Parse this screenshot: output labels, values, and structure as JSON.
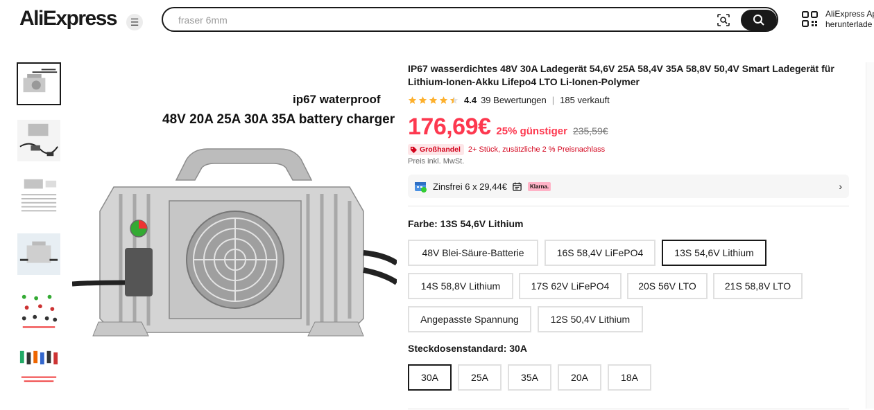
{
  "header": {
    "logo": "AliExpress",
    "search_placeholder": "fraser 6mm",
    "app_line1": "AliExpress Ap",
    "app_line2": "herunterlade"
  },
  "gallery": {
    "image_text_line1": "ip67 waterproof",
    "image_text_line2": "48V 20A 25A 30A 35A battery charger"
  },
  "product": {
    "title": "IP67 wasserdichtes 48V 30A Ladegerät 54,6V 25A 58,4V 35A 58,8V 50,4V Smart Ladegerät für Lithium-Ionen-Akku Lifepo4 LTO Li-Ionen-Polymer",
    "rating": "4.4",
    "reviews": "39 Bewertungen",
    "separator": "|",
    "sold": "185 verkauft",
    "stars": 4.4,
    "price": "176,69€",
    "discount": "25% günstiger",
    "old_price": "235,59€",
    "bulk_badge": "Großhandel",
    "bulk_text": "2+ Stück, zusätzliche 2 % Preisnachlass",
    "tax_note": "Preis inkl. MwSt.",
    "installment": "Zinsfrei 6 x 29,44€",
    "klarna": "Klarna."
  },
  "color": {
    "label": "Farbe: 13S 54,6V Lithium",
    "options": [
      "48V Blei-Säure-Batterie",
      "16S 58,4V LiFePO4",
      "13S 54,6V Lithium",
      "14S 58,8V Lithium",
      "17S 62V LiFePO4",
      "20S 56V LTO",
      "21S 58,8V LTO",
      "Angepasste Spannung",
      "12S 50,4V Lithium"
    ],
    "selected": "13S 54,6V Lithium"
  },
  "plug": {
    "label": "Steckdosenstandard: 30A",
    "options": [
      "30A",
      "25A",
      "35A",
      "20A",
      "18A"
    ],
    "selected": "30A"
  },
  "colors": {
    "accent": "#fd384f",
    "text": "#191919"
  }
}
